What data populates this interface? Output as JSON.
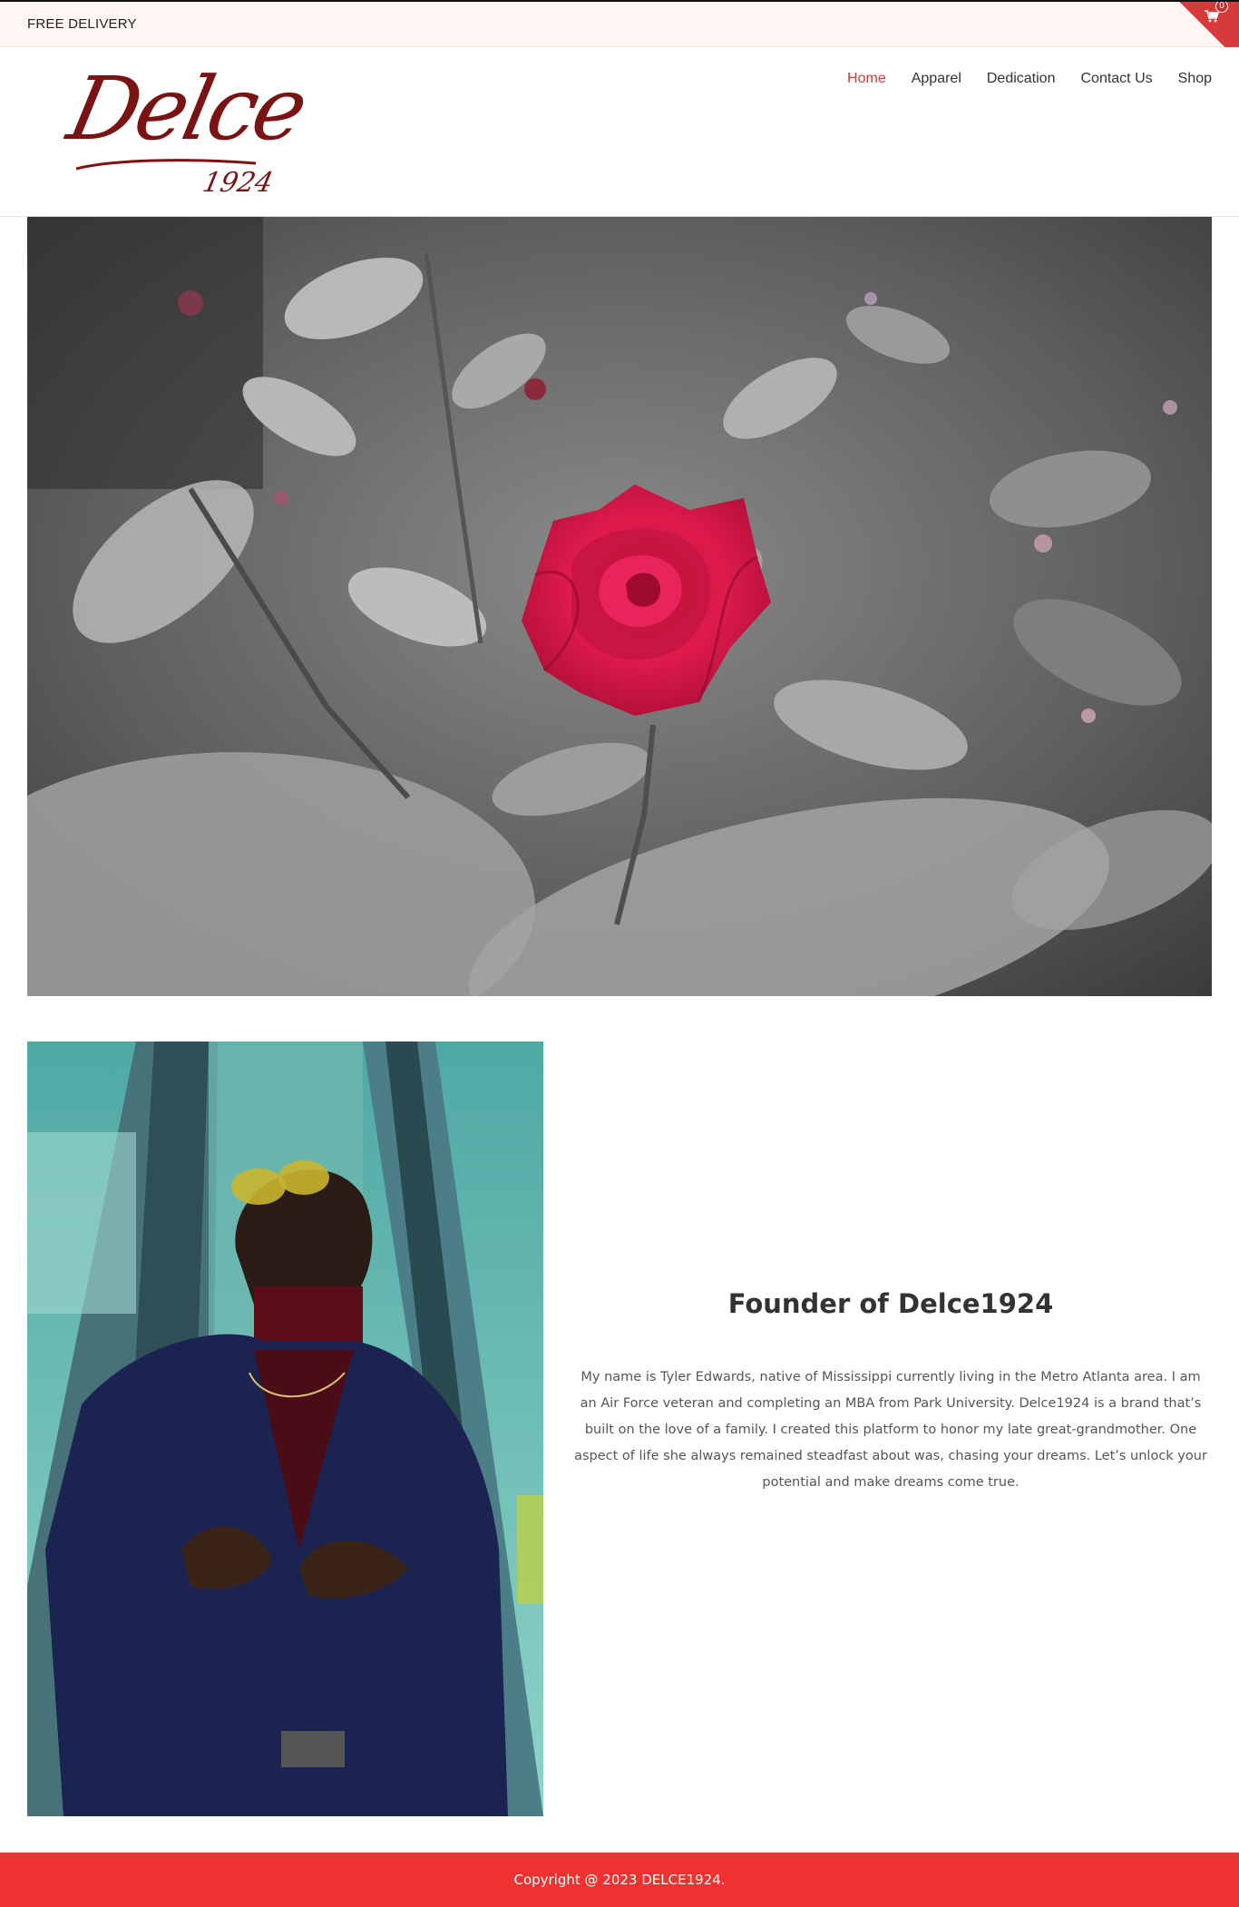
{
  "topbar": {
    "promo": "FREE DELIVERY",
    "cart_count": "0"
  },
  "logo": {
    "main": "Delce",
    "sub": "1924"
  },
  "nav": [
    {
      "label": "Home",
      "active": true
    },
    {
      "label": "Apparel",
      "active": false
    },
    {
      "label": "Dedication",
      "active": false
    },
    {
      "label": "Contact Us",
      "active": false
    },
    {
      "label": "Shop",
      "active": false
    }
  ],
  "founder": {
    "title": "Founder of Delce1924",
    "bio": "My name is Tyler Edwards, native of Mississippi currently living in the Metro Atlanta area. I am an Air Force veteran and completing an MBA from Park University. Delce1924 is a brand that’s built on the love of a family. I created this platform to honor my late great-grandmother. One aspect of life she always remained steadfast about was, chasing your dreams. Let’s unlock your potential and make dreams come true."
  },
  "footer": {
    "copyright": "Copyright @ 2023 DELCE1924."
  },
  "colors": {
    "accent": "#f0312f",
    "logo": "#7a1414",
    "nav_active": "#d43a3a"
  }
}
